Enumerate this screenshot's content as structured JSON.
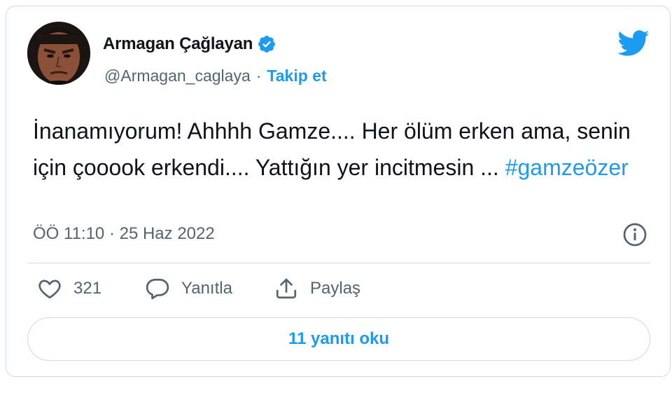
{
  "author": {
    "display_name": "Armagan Çağlayan",
    "handle": "@Armagan_caglaya",
    "separator": "·",
    "follow_label": "Takip et",
    "verified": true
  },
  "tweet": {
    "text": "İnanamıyorum! Ahhhh Gamze.... Her ölüm erken ama, senin için çooook erkendi.... Yattığın yer incitmesin ... ",
    "hashtag": "#gamzeözer",
    "timestamp": "ÖÖ 11:10 · 25 Haz 2022"
  },
  "actions": {
    "like_count": "321",
    "reply_label": "Yanıtla",
    "share_label": "Paylaş"
  },
  "replies_button": "11 yanıtı oku",
  "icons": {
    "platform": "twitter-bird-icon",
    "verified": "verified-badge-icon",
    "info": "info-icon",
    "like": "heart-icon",
    "reply": "speech-bubble-icon",
    "share": "share-upload-icon"
  },
  "colors": {
    "accent": "#1d9bf0",
    "text_primary": "#0f1419",
    "text_secondary": "#536471",
    "border": "#cfd9de"
  }
}
